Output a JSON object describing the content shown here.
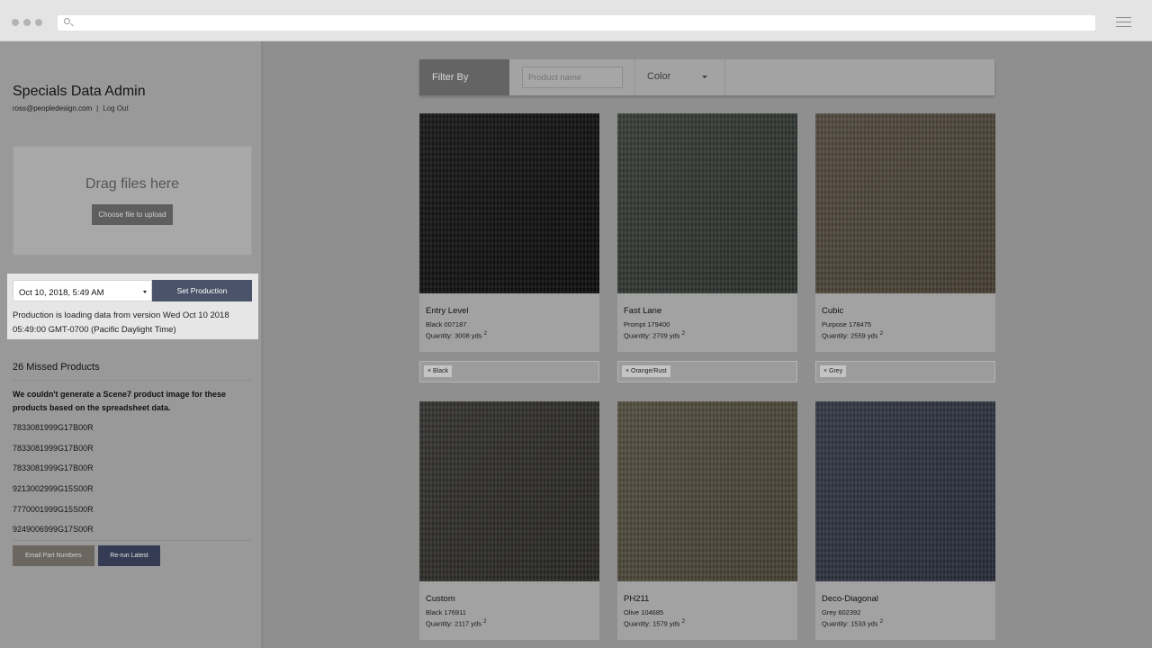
{
  "sidebar": {
    "title": "Specials Data Admin",
    "user_email": "ross@peopledesign.com",
    "separator": "|",
    "logout_label": "Log Out",
    "upload": {
      "drag_text": "Drag files here",
      "choose_label": "Choose file to upload"
    },
    "production": {
      "date_value": "Oct 10, 2018, 5:49 AM",
      "set_label": "Set Production",
      "message": "Production is loading data from version Wed Oct 10 2018 05:49:00 GMT-0700 (Pacific Daylight Time)"
    },
    "missed": {
      "title": "26 Missed Products",
      "description": "We couldn't generate a Scene7 product image for these products based on the spreadsheet data.",
      "items": [
        "7833081999G17B00R",
        "7833081999G17B00R",
        "7833081999G17B00R",
        "9213002999G15S00R",
        "7770001999G15S00R",
        "9249006999G17S00R"
      ],
      "email_label": "Email Part Numbers",
      "rerun_label": "Re-run Latest"
    }
  },
  "filter": {
    "label": "Filter By",
    "product_placeholder": "Product name",
    "color_label": "Color"
  },
  "products": [
    {
      "name": "Entry Level",
      "variant": "Black 007187",
      "quantity": "Quantity: 3008 yds",
      "unit_sup": "2",
      "tag": "× Black",
      "swatch_color": "#0e0e0e"
    },
    {
      "name": "Fast Lane",
      "variant": "Prompt 179400",
      "quantity": "Quantity: 2709 yds",
      "unit_sup": "2",
      "tag": "× Orange/Rust",
      "swatch_color": "#2f342f"
    },
    {
      "name": "Cubic",
      "variant": "Purpose 178475",
      "quantity": "Quantity: 2559 yds",
      "unit_sup": "2",
      "tag": "× Grey",
      "swatch_color": "#4a4236"
    },
    {
      "name": "Custom",
      "variant": "Black 176911",
      "quantity": "Quantity: 2117 yds",
      "unit_sup": "2",
      "tag": "",
      "swatch_color": "#2b2a27"
    },
    {
      "name": "PH211",
      "variant": "Olive 104685",
      "quantity": "Quantity: 1579 yds",
      "unit_sup": "2",
      "tag": "",
      "swatch_color": "#4a4637"
    },
    {
      "name": "Deco-Diagonal",
      "variant": "Grey 602392",
      "quantity": "Quantity: 1533 yds",
      "unit_sup": "2",
      "tag": "",
      "swatch_color": "#2a2f3c"
    }
  ]
}
